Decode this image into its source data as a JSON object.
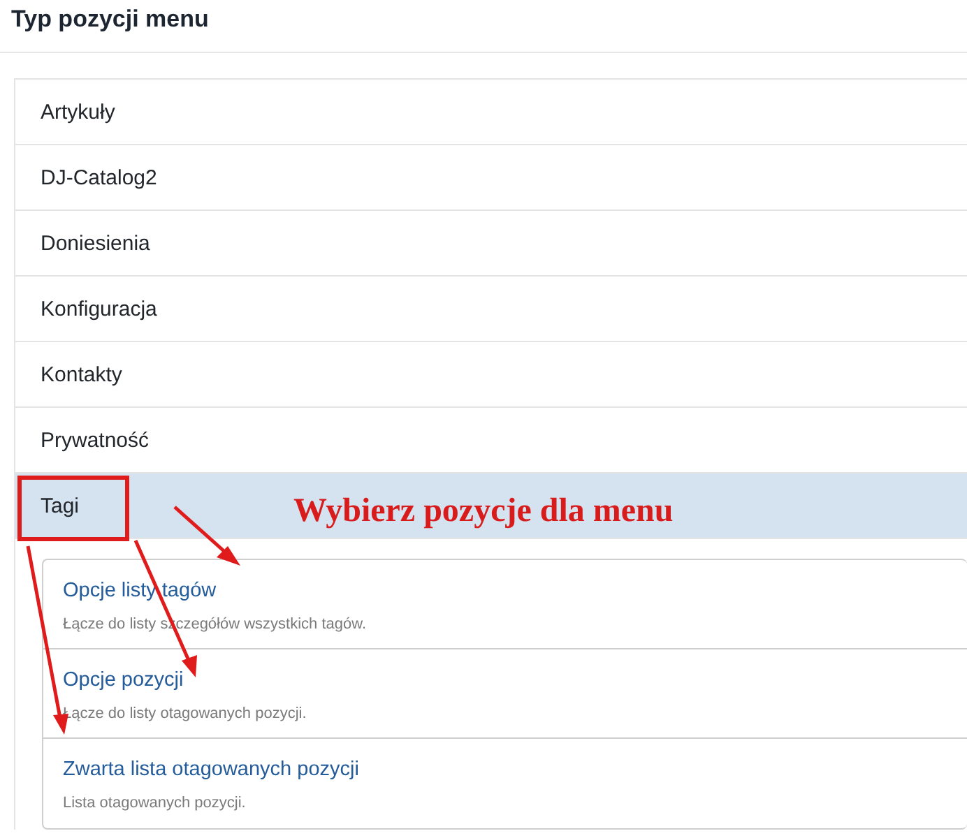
{
  "title": "Typ pozycji menu",
  "categories": [
    {
      "label": "Artykuły",
      "selected": false
    },
    {
      "label": "DJ-Catalog2",
      "selected": false
    },
    {
      "label": "Doniesienia",
      "selected": false
    },
    {
      "label": "Konfiguracja",
      "selected": false
    },
    {
      "label": "Kontakty",
      "selected": false
    },
    {
      "label": "Prywatność",
      "selected": false
    },
    {
      "label": "Tagi",
      "selected": true
    }
  ],
  "options": [
    {
      "title": "Opcje listy tagów",
      "description": "Łącze do listy szczegółów wszystkich tagów."
    },
    {
      "title": "Opcje pozycji",
      "description": "Łącze do listy otagowanych pozycji."
    },
    {
      "title": "Zwarta lista otagowanych pozycji",
      "description": "Lista otagowanych pozycji."
    }
  ],
  "annotation": {
    "text": "Wybierz pozycje dla menu"
  }
}
